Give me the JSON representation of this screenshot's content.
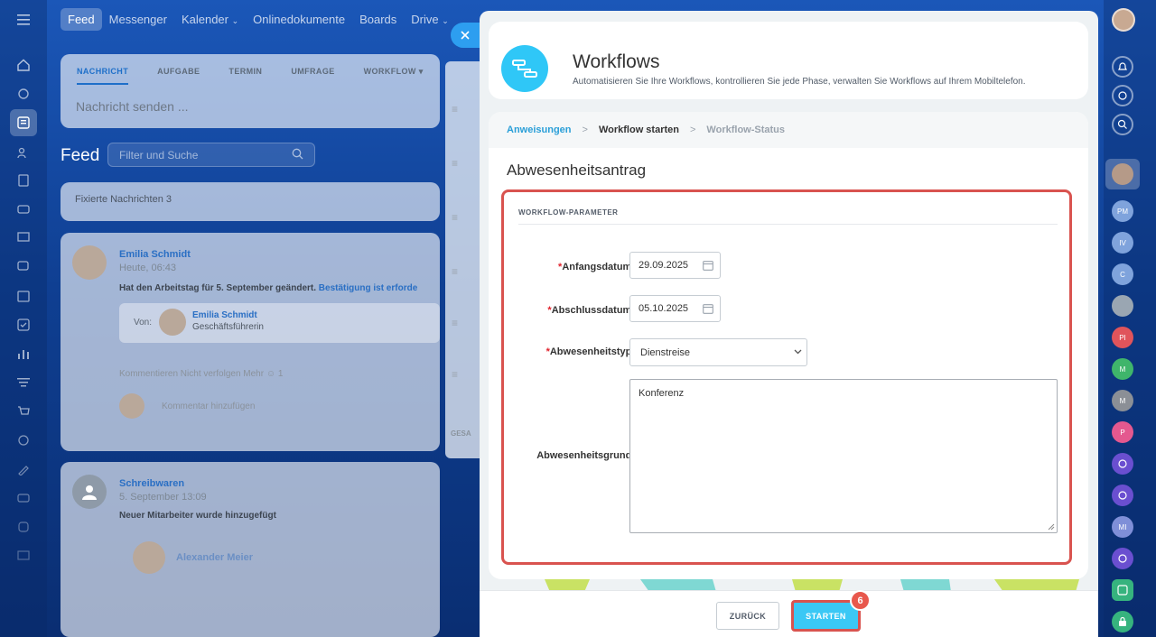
{
  "topnav": {
    "items": [
      "Feed",
      "Messenger",
      "Kalender",
      "Onlinedokumente",
      "Boards",
      "Drive"
    ]
  },
  "background": {
    "composer_tabs": [
      "NACHRICHT",
      "AUFGABE",
      "TERMIN",
      "UMFRAGE",
      "WORKFLOW"
    ],
    "composer_placeholder": "Nachricht senden ...",
    "feed_title": "Feed",
    "feed_search_placeholder": "Filter und Suche",
    "pinned": "Fixierte Nachrichten 3",
    "post1": {
      "author": "Emilia Schmidt",
      "time": "Heute, 06:43",
      "text": "Hat den Arbeitstag für 5. September geändert.",
      "link": "Bestätigung ist erforde",
      "from_label": "Von:",
      "from_name": "Emilia Schmidt",
      "from_role": "Geschäftsführerin",
      "actions": "Kommentieren   Nicht verfolgen   Mehr   ☺ 1",
      "comment_placeholder": "Kommentar hinzufügen"
    },
    "post2": {
      "author": "Schreibwaren",
      "time": "5. September 13:09",
      "text": "Neuer Mitarbeiter wurde hinzugefügt",
      "person": "Alexander Meier"
    },
    "sliver_footer": "GESA"
  },
  "panel": {
    "title": "Workflows",
    "subtitle": "Automatisieren Sie Ihre Workflows, kontrollieren Sie jede Phase, verwalten Sie Workflows auf Ihrem Mobiltelefon.",
    "breadcrumb": {
      "step1": "Anweisungen",
      "step2": "Workflow starten",
      "step3": "Workflow-Status"
    },
    "form_title": "Abwesenheitsantrag",
    "section_label": "WORKFLOW-PARAMETER",
    "fields": {
      "start_label": "Anfangsdatum:",
      "start_value": "29.09.2025",
      "end_label": "Abschlussdatum:",
      "end_value": "05.10.2025",
      "type_label": "Abwesenheitstyp:",
      "type_value": "Dienstreise",
      "reason_label": "Abwesenheitsgrund:",
      "reason_value": "Konferenz",
      "required_mark": "*"
    },
    "buttons": {
      "back": "ZURÜCK",
      "start": "STARTEN",
      "step_badge": "6"
    }
  },
  "right_rail": {
    "initials": [
      "PM",
      "IV",
      "C",
      "PI",
      "M",
      "M",
      "P",
      "MI"
    ]
  },
  "colors": {
    "accent": "#3bc8f5",
    "link": "#2a9fd8",
    "highlight": "#d9534f",
    "required": "#e0222c"
  }
}
